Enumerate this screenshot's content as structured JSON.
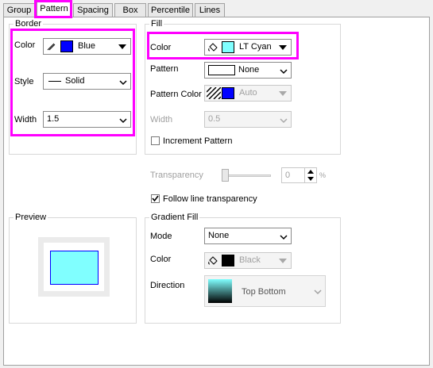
{
  "tabs": [
    "Group",
    "Pattern",
    "Spacing",
    "Box",
    "Percentile",
    "Lines"
  ],
  "active_tab": "Pattern",
  "border": {
    "title": "Border",
    "color_label": "Color",
    "color_value": "Blue",
    "color_swatch": "#0000ff",
    "style_label": "Style",
    "style_value": "Solid",
    "width_label": "Width",
    "width_value": "1.5"
  },
  "fill": {
    "title": "Fill",
    "color_label": "Color",
    "color_value": "LT Cyan",
    "color_swatch": "#80ffff",
    "pattern_label": "Pattern",
    "pattern_value": "None",
    "pattern_color_label": "Pattern Color",
    "pattern_color_value": "Auto",
    "width_label": "Width",
    "width_value": "0.5",
    "increment_label": "Increment Pattern",
    "increment_checked": false
  },
  "transparency": {
    "label": "Transparency",
    "value": "0",
    "unit": "%",
    "slider_fraction": 0.0
  },
  "follow_line": {
    "label": "Follow line transparency",
    "checked": true
  },
  "preview": {
    "title": "Preview",
    "fill_color": "#80ffff",
    "border_color": "#0000ff"
  },
  "gradient": {
    "title": "Gradient Fill",
    "mode_label": "Mode",
    "mode_value": "None",
    "color_label": "Color",
    "color_value": "Black",
    "direction_label": "Direction",
    "direction_value": "Top Bottom"
  },
  "highlight_color": "#ff00ff"
}
